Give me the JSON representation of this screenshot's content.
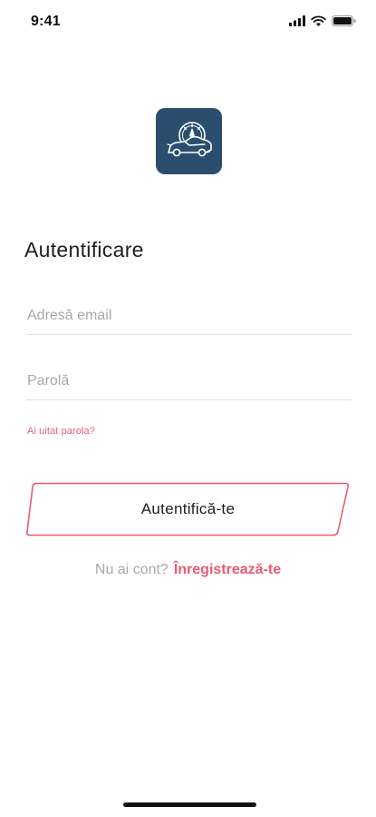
{
  "status_bar": {
    "time": "9:41",
    "icons": [
      "cellular-signal-icon",
      "wifi-icon",
      "battery-icon"
    ]
  },
  "logo": {
    "icon": "car-speedometer-icon",
    "background": "#2b4e6e"
  },
  "title": "Autentificare",
  "form": {
    "email": {
      "placeholder": "Adresă email",
      "value": ""
    },
    "password": {
      "placeholder": "Parolă",
      "value": ""
    },
    "forgot_password": "Ai uitat parola?",
    "submit_label": "Autentifică-te"
  },
  "signup": {
    "prompt": "Nu ai cont?",
    "link": "Înregistrează-te"
  },
  "colors": {
    "accent": "#ea5b74",
    "logo_bg": "#2b4e6e",
    "placeholder": "#a8a8a8"
  }
}
